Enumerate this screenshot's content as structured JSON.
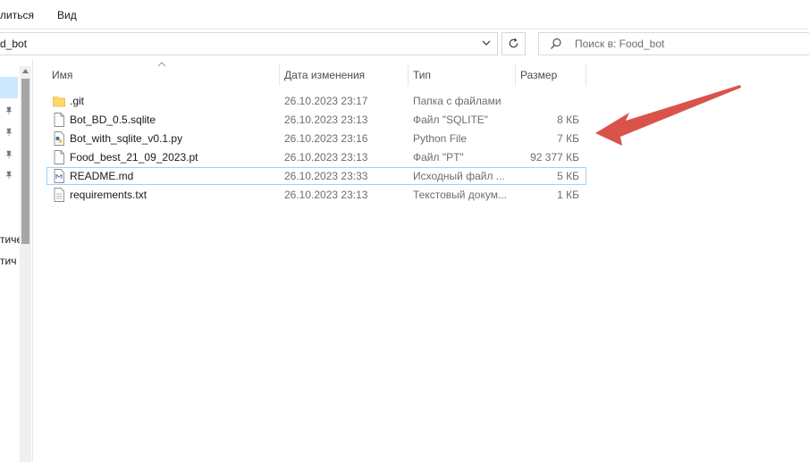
{
  "ribbon": {
    "tab_share": "литься",
    "tab_view": "Вид"
  },
  "address": {
    "path": "d_bot"
  },
  "search": {
    "placeholder": "Поиск в: Food_bot"
  },
  "nav": {
    "item1": "тиче",
    "item2": "тич"
  },
  "columns": {
    "name": "Имя",
    "date": "Дата изменения",
    "type": "Тип",
    "size": "Размер"
  },
  "files": [
    {
      "name": ".git",
      "date": "26.10.2023 23:17",
      "type": "Папка с файлами",
      "size": "",
      "icon": "folder-icon"
    },
    {
      "name": "Bot_BD_0.5.sqlite",
      "date": "26.10.2023 23:13",
      "type": "Файл \"SQLITE\"",
      "size": "8 КБ",
      "icon": "file-icon"
    },
    {
      "name": "Bot_with_sqlite_v0.1.py",
      "date": "26.10.2023 23:16",
      "type": "Python File",
      "size": "7 КБ",
      "icon": "python-file-icon"
    },
    {
      "name": "Food_best_21_09_2023.pt",
      "date": "26.10.2023 23:13",
      "type": "Файл \"PT\"",
      "size": "92 377 КБ",
      "icon": "file-icon"
    },
    {
      "name": "README.md",
      "date": "26.10.2023 23:33",
      "type": "Исходный файл ...",
      "size": "5 КБ",
      "icon": "markdown-file-icon"
    },
    {
      "name": "requirements.txt",
      "date": "26.10.2023 23:13",
      "type": "Текстовый докум...",
      "size": "1 КБ",
      "icon": "text-file-icon"
    }
  ],
  "colors": {
    "arrow": "#d9534a",
    "selection": "#cce8ff",
    "focus_border": "#99d1ff",
    "folder": "#ffd866"
  }
}
